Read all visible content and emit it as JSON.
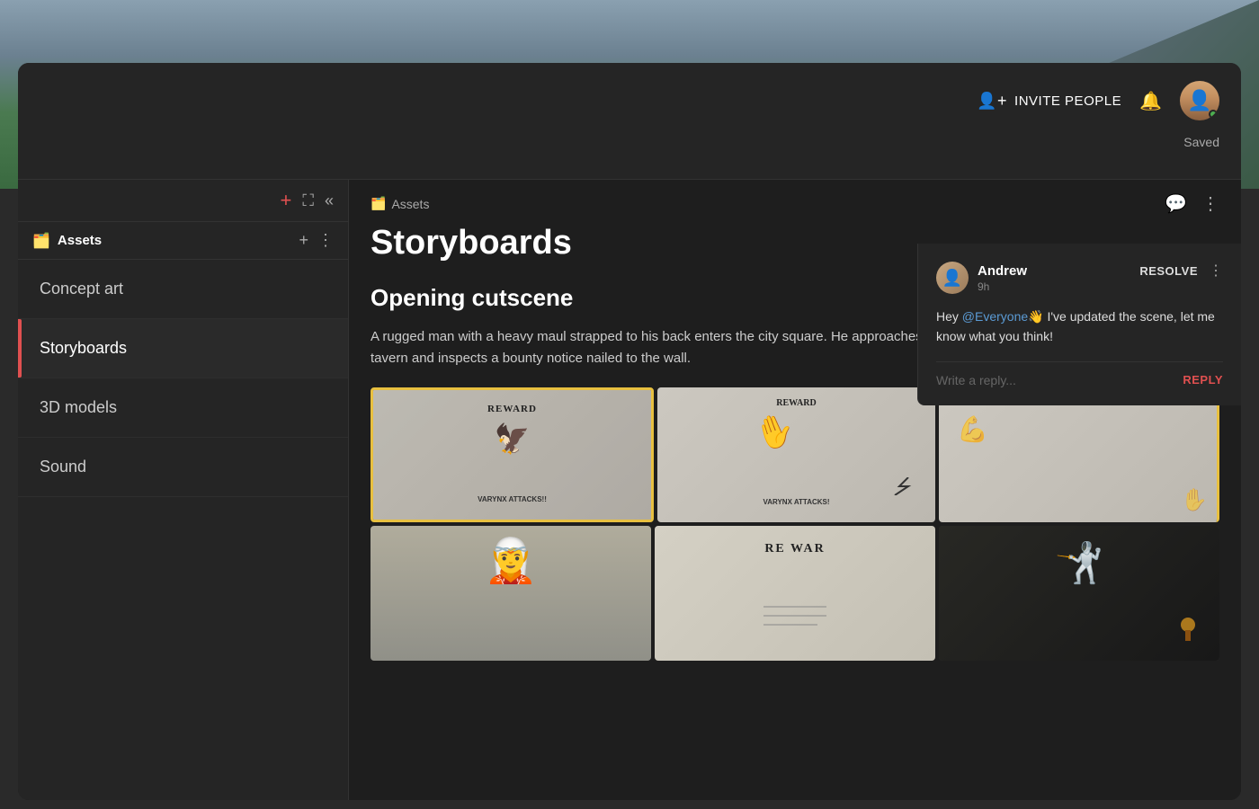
{
  "background": {
    "colors": [
      "#8aa0b0",
      "#4a7a50"
    ]
  },
  "header": {
    "invite_label": "INVITE PEOPLE",
    "saved_label": "Saved"
  },
  "sidebar": {
    "tools": {
      "add_label": "+",
      "expand_label": "⛶",
      "collapse_label": "«"
    },
    "assets_label": "Assets",
    "assets_emoji": "🗂️",
    "add_btn_label": "+",
    "more_btn_label": "⋮",
    "nav_items": [
      {
        "id": "concept-art",
        "label": "Concept art",
        "active": false
      },
      {
        "id": "storyboards",
        "label": "Storyboards",
        "active": true
      },
      {
        "id": "3d-models",
        "label": "3D models",
        "active": false
      },
      {
        "id": "sound",
        "label": "Sound",
        "active": false
      }
    ]
  },
  "breadcrumb": {
    "emoji": "🗂️",
    "label": "Assets"
  },
  "content": {
    "page_title": "Storyboards",
    "section_heading": "Opening cutscene",
    "description": "A rugged man with a heavy maul strapped to his back enters the city square. He approaches an old tavern and inspects a bounty notice nailed to the wall.",
    "images": [
      {
        "id": "img-1",
        "selected": true,
        "label": "VARYNX ATTACKS!!"
      },
      {
        "id": "img-2",
        "selected": false,
        "label": "VARYNX ATTACKS!"
      },
      {
        "id": "img-3",
        "selected": false,
        "partial": true,
        "label": ""
      },
      {
        "id": "img-4",
        "selected": false,
        "label": ""
      },
      {
        "id": "img-5",
        "selected": false,
        "label": ""
      },
      {
        "id": "img-6",
        "selected": false,
        "label": ""
      }
    ]
  },
  "comment": {
    "username": "Andrew",
    "time": "9h",
    "resolve_label": "RESOLVE",
    "body_before_mention": "Hey ",
    "mention": "@Everyone",
    "mention_emoji": "👋",
    "body_after": " I've updated the scene, let me know what you think!",
    "reply_placeholder": "Write a reply...",
    "reply_label": "REPLY"
  },
  "icons": {
    "comment_icon": "💬",
    "more_icon": "⋮",
    "bell_icon": "🔔"
  }
}
